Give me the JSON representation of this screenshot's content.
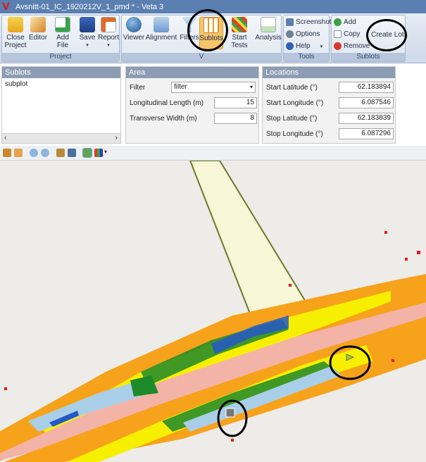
{
  "titlebar": {
    "title": "Avsnitt-01_IC_1920212V_1_pmd * - Veta 3"
  },
  "ribbon": {
    "project": {
      "label": "Project",
      "buttons": [
        {
          "label": "Close\nProject",
          "icon": "folder-close-icon"
        },
        {
          "label": "Editor",
          "icon": "editor-icon"
        },
        {
          "label": "Add File",
          "icon": "add-file-icon"
        },
        {
          "label": "Save",
          "icon": "save-icon"
        },
        {
          "label": "Report",
          "icon": "report-icon"
        }
      ]
    },
    "view": {
      "label": "V",
      "buttons": [
        {
          "label": "Viewer",
          "icon": "globe-icon"
        },
        {
          "label": "Alignment",
          "icon": "alignment-icon"
        },
        {
          "label": "Filters",
          "icon": "filter-icon"
        },
        {
          "label": "Sublots",
          "icon": "sublots-icon"
        },
        {
          "label": "Start Tests",
          "icon": "start-tests-icon"
        },
        {
          "label": "Analysis",
          "icon": "analysis-icon"
        }
      ]
    },
    "tools": {
      "label": "Tools",
      "buttons": [
        {
          "label": "Screenshot",
          "icon": "screenshot-icon"
        },
        {
          "label": "Options",
          "icon": "options-icon"
        },
        {
          "label": "Help",
          "icon": "help-icon"
        }
      ]
    },
    "sublots": {
      "label": "Sublots",
      "buttons": [
        {
          "label": "Add",
          "icon": "add-icon"
        },
        {
          "label": "Copy",
          "icon": "copy-icon"
        },
        {
          "label": "Remove",
          "icon": "remove-icon"
        }
      ],
      "create_lots": "Create Lots"
    }
  },
  "sublots_panel": {
    "title": "Sublots",
    "items": [
      "subplot"
    ]
  },
  "area_panel": {
    "title": "Area",
    "filter_label": "Filter",
    "filter_value": "filter",
    "long_label": "Longitudinal Length (m)",
    "long_value": "15",
    "trans_label": "Transverse Width (m)",
    "trans_value": "8"
  },
  "locations_panel": {
    "title": "Locations",
    "rows": [
      {
        "label": "Start Latitude (°)",
        "value": "62.183894"
      },
      {
        "label": "Start Longitude (°)",
        "value": "6.087546"
      },
      {
        "label": "Stop Latitude (°)",
        "value": "62.183839"
      },
      {
        "label": "Stop Longitude (°)",
        "value": "6.087296"
      }
    ]
  },
  "colors": {
    "titlebar": "#5a7fb0",
    "road": "#f4b3a7",
    "lane": "#f7f6d6",
    "orange": "#f7a21b",
    "yellow": "#f6f000",
    "green": "#1f8a2a",
    "lightblue": "#a9cfe8",
    "blue": "#2458c8",
    "red": "#e41a1a"
  }
}
